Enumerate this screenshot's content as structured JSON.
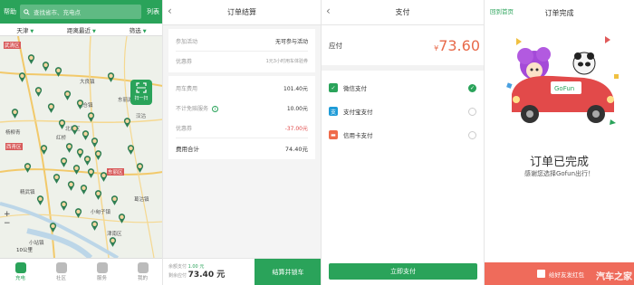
{
  "map_screen": {
    "help": "帮助",
    "search_placeholder": "查找省市、充电点",
    "list": "列表",
    "filters": [
      "天津",
      "距离最近",
      "筛选"
    ],
    "scan_label": "扫一扫",
    "scale": "10公里",
    "zoom_in": "+",
    "zoom_out": "−",
    "map_labels": [
      {
        "text": "武清区",
        "hot": true
      },
      {
        "text": "大良镇",
        "hot": false
      },
      {
        "text": "北辰区",
        "hot": false
      },
      {
        "text": "汉沽",
        "hot": false
      },
      {
        "text": "东丽湖",
        "hot": false
      },
      {
        "text": "杨柳青",
        "hot": false
      },
      {
        "text": "西青区",
        "hot": true
      },
      {
        "text": "东丽区",
        "hot": true
      },
      {
        "text": "精武镇",
        "hot": false
      },
      {
        "text": "葛沽镇",
        "hot": false
      },
      {
        "text": "津南区",
        "hot": false
      },
      {
        "text": "小站镇",
        "hot": false
      },
      {
        "text": "小甸子镇",
        "hot": false
      },
      {
        "text": "红桥",
        "hot": false
      },
      {
        "text": "北仓镇",
        "hot": false
      }
    ],
    "tabs": [
      {
        "label": "充电",
        "active": true
      },
      {
        "label": "社区",
        "active": false
      },
      {
        "label": "服务",
        "active": false
      },
      {
        "label": "我的",
        "active": false
      }
    ]
  },
  "settlement": {
    "title": "订单结算",
    "activity_label": "参加活动",
    "activity_value": "无可参与活动",
    "coupon_label": "优惠券",
    "coupon_value": "1元3小时用车体验券",
    "car_fee_label": "用车费用",
    "car_fee_value": "101.40元",
    "deductible_label": "不计免赔服务",
    "deductible_value": "10.00元",
    "discount_label": "优惠券",
    "discount_value": "-37.00元",
    "total_label": "费用合计",
    "total_value": "74.40元",
    "balance_label": "余额支付",
    "balance_value": "1.00 元",
    "remaining_label": "剩余应付",
    "remaining_value": "73.40 元",
    "button": "结算并锁车"
  },
  "payment": {
    "title": "支付",
    "amount_label": "应付",
    "currency": "¥",
    "amount": "73.60",
    "methods": [
      {
        "name": "微信支付",
        "color": "#2aa35a",
        "glyph": "✓",
        "selected": true
      },
      {
        "name": "支付宝支付",
        "color": "#1e9bd7",
        "glyph": "支",
        "selected": false
      },
      {
        "name": "信用卡支付",
        "color": "#ef6b4a",
        "glyph": "▬",
        "selected": false
      }
    ],
    "button": "立即支付"
  },
  "complete": {
    "home_link": "回到首页",
    "title": "订单完成",
    "heading": "订单已完成",
    "subtitle": "感谢您选择Gofun出行！",
    "share": "给好友发红包",
    "watermark": "汽车之家"
  },
  "colors": {
    "brand_green": "#2aa35a",
    "price_red": "#e04848",
    "coral": "#ef6b5b"
  }
}
